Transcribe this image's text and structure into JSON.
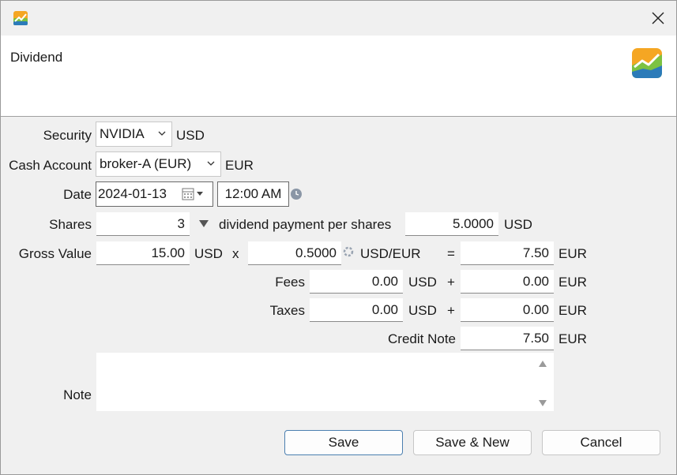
{
  "header": {
    "title": "Dividend"
  },
  "security": {
    "label": "Security",
    "value": "NVIDIA",
    "currency": "USD"
  },
  "cash_account": {
    "label": "Cash Account",
    "value": "broker-A (EUR)",
    "currency": "EUR"
  },
  "date": {
    "label": "Date",
    "value": "2024-01-13",
    "time": "12:00 AM"
  },
  "shares": {
    "label": "Shares",
    "value": "3",
    "per_share_label": "dividend payment per shares",
    "per_share_value": "5.0000",
    "per_share_currency": "USD"
  },
  "gross": {
    "label": "Gross Value",
    "value": "15.00",
    "currency": "USD",
    "op": "x",
    "rate": "0.5000",
    "rate_unit": "USD/EUR",
    "eq": "=",
    "converted": "7.50",
    "converted_currency": "EUR"
  },
  "fees": {
    "label": "Fees",
    "value": "0.00",
    "currency": "USD",
    "op": "+",
    "converted": "0.00",
    "converted_currency": "EUR"
  },
  "taxes": {
    "label": "Taxes",
    "value": "0.00",
    "currency": "USD",
    "op": "+",
    "converted": "0.00",
    "converted_currency": "EUR"
  },
  "credit_note": {
    "label": "Credit Note",
    "value": "7.50",
    "currency": "EUR"
  },
  "note": {
    "label": "Note",
    "value": ""
  },
  "buttons": {
    "save": "Save",
    "save_new": "Save & New",
    "cancel": "Cancel"
  },
  "colors": {
    "accent": "#4b7fb0",
    "logo_orange": "#f5a623",
    "logo_green": "#7cc242",
    "logo_blue": "#2b7bb9"
  }
}
